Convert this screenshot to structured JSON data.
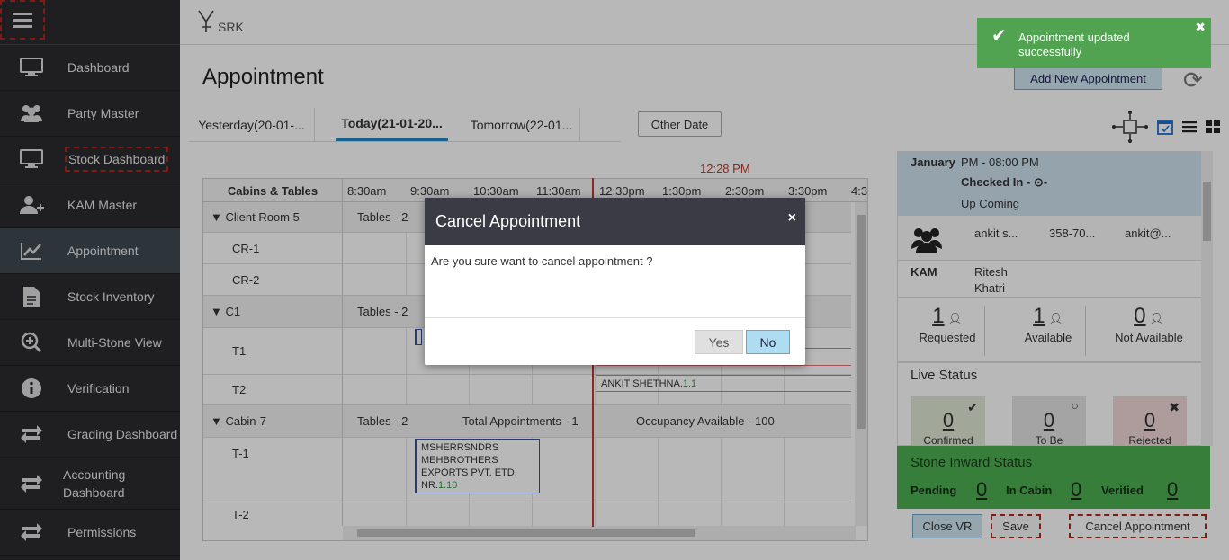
{
  "sidebar": {
    "items": [
      {
        "label": "Dashboard",
        "icon": "monitor-icon"
      },
      {
        "label": "Party Master",
        "icon": "users-icon"
      },
      {
        "label": "Stock Dashboard",
        "icon": "monitor-icon"
      },
      {
        "label": "KAM Master",
        "icon": "user-plus-icon"
      },
      {
        "label": "Appointment",
        "icon": "chart-line-icon"
      },
      {
        "label": "Stock Inventory",
        "icon": "document-icon"
      },
      {
        "label": "Multi-Stone View",
        "icon": "zoom-in-icon"
      },
      {
        "label": "Verification",
        "icon": "info-icon"
      },
      {
        "label": "Grading Dashboard",
        "icon": "exchange-icon"
      },
      {
        "label": "Accounting Dashboard",
        "icon": "exchange-icon"
      },
      {
        "label": "Permissions",
        "icon": "exchange-icon"
      }
    ]
  },
  "header": {
    "logo_text": "SRK"
  },
  "page": {
    "title": "Appointment",
    "add_button": "Add New Appointment"
  },
  "tabs": [
    {
      "label": "Yesterday(20-01-..."
    },
    {
      "label": "Today(21-01-20..."
    },
    {
      "label": "Tomorrow(22-01..."
    }
  ],
  "other_date": "Other Date",
  "grid": {
    "now_label": "12:28 PM",
    "first_col": "Cabins & Tables",
    "times": [
      "8:30am",
      "9:30am",
      "10:30am",
      "11:30am",
      "12:30pm",
      "1:30pm",
      "2:30pm",
      "3:30pm",
      "4:3"
    ],
    "rows": [
      {
        "name": "Client Room 5",
        "group": true,
        "tables": "Tables - 2"
      },
      {
        "name": "CR-1"
      },
      {
        "name": "CR-2"
      },
      {
        "name": "C1",
        "group": true,
        "tables": "Tables - 2"
      },
      {
        "name": "T1"
      },
      {
        "name": "T2"
      },
      {
        "name": "Cabin-7",
        "group": true,
        "tables": "Tables - 2",
        "total": "Total Appointments - 1",
        "occupancy": "Occupancy Available - 100"
      },
      {
        "name": "T-1"
      },
      {
        "name": "T-2"
      }
    ],
    "appt_t2": {
      "name": "ANKIT SHETHNA.",
      "count": "1.1"
    },
    "appt_t1": {
      "lines": [
        "MSHERRSNDRS",
        "MEHBROTHERS",
        "EXPORTS PVT. ETD.",
        "NR."
      ],
      "count": "1.10"
    }
  },
  "details": {
    "month": "January",
    "time": "PM - 08:00 PM",
    "checked_in": "Checked In -",
    "status": "Up Coming",
    "contact_name": "ankit s...",
    "contact_phone": "358-70...",
    "contact_email": "ankit@...",
    "kam_label": "KAM",
    "kam_name_1": "Ritesh",
    "kam_name_2": "Khatri",
    "counts": [
      {
        "value": "1",
        "label": "Requested"
      },
      {
        "value": "1",
        "label": "Available"
      },
      {
        "value": "0",
        "label": "Not Available"
      }
    ],
    "live_status": "Live Status",
    "live": [
      {
        "value": "0",
        "label": "Confirmed",
        "color": "#dfe9d6"
      },
      {
        "value": "0",
        "label": "To Be",
        "color": "#e4e4e4"
      },
      {
        "value": "0",
        "label": "Rejected",
        "color": "#f1d9d9"
      }
    ]
  },
  "stone": {
    "title": "Stone Inward Status",
    "pending_label": "Pending",
    "pending_value": "0",
    "incabin_label": "In Cabin",
    "incabin_value": "0",
    "verified_label": "Verified",
    "verified_value": "0"
  },
  "actions": {
    "close_vr": "Close VR",
    "save": "Save",
    "cancel": "Cancel Appointment"
  },
  "toast": {
    "message": "Appointment updated successfully"
  },
  "modal": {
    "title": "Cancel Appointment",
    "close": "×",
    "body": "Are you sure want to cancel appointment ?",
    "yes": "Yes",
    "no": "No"
  },
  "colors": {
    "sidebar": "#2b2b30",
    "active": "#3f4a52",
    "toast": "#51a351",
    "stone": "#4caf50",
    "now": "#c0392b"
  }
}
